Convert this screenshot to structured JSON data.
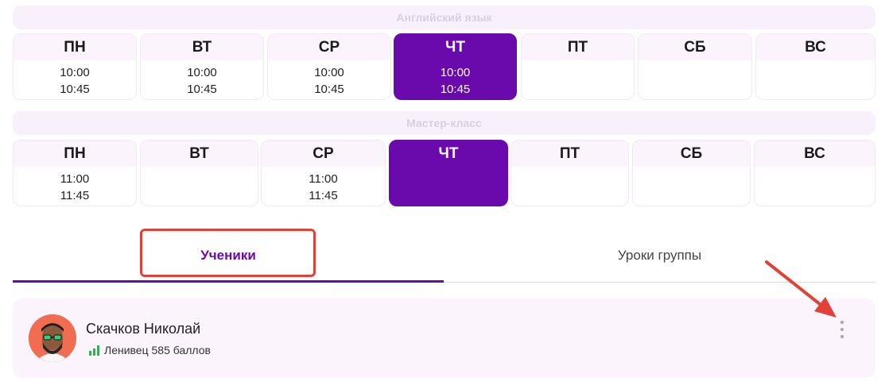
{
  "schedules": [
    {
      "title": "Английский язык",
      "days": [
        {
          "label": "ПН",
          "start": "10:00",
          "end": "10:45",
          "active": false
        },
        {
          "label": "ВТ",
          "start": "10:00",
          "end": "10:45",
          "active": false
        },
        {
          "label": "СР",
          "start": "10:00",
          "end": "10:45",
          "active": false
        },
        {
          "label": "ЧТ",
          "start": "10:00",
          "end": "10:45",
          "active": true
        },
        {
          "label": "ПТ",
          "start": "",
          "end": "",
          "active": false
        },
        {
          "label": "СБ",
          "start": "",
          "end": "",
          "active": false
        },
        {
          "label": "ВС",
          "start": "",
          "end": "",
          "active": false
        }
      ]
    },
    {
      "title": "Мастер-класс",
      "days": [
        {
          "label": "ПН",
          "start": "11:00",
          "end": "11:45",
          "active": false
        },
        {
          "label": "ВТ",
          "start": "",
          "end": "",
          "active": false
        },
        {
          "label": "СР",
          "start": "11:00",
          "end": "11:45",
          "active": false
        },
        {
          "label": "ЧТ",
          "start": "",
          "end": "",
          "active": true
        },
        {
          "label": "ПТ",
          "start": "",
          "end": "",
          "active": false
        },
        {
          "label": "СБ",
          "start": "",
          "end": "",
          "active": false
        },
        {
          "label": "ВС",
          "start": "",
          "end": "",
          "active": false
        }
      ]
    }
  ],
  "tabs": {
    "students": "Ученики",
    "lessons": "Уроки группы",
    "active": "students"
  },
  "student": {
    "name": "Скачков Николай",
    "level": "Ленивец 585 баллов",
    "avatar_icon": "bearded-man-with-glasses-avatar",
    "level_icon": "signal-bars-icon",
    "menu_icon": "kebab-menu-icon"
  },
  "colors": {
    "accent": "#6b0aac",
    "highlight": "#e04237",
    "card_bg": "#fbf4fc",
    "level_green": "#2fb24c"
  }
}
